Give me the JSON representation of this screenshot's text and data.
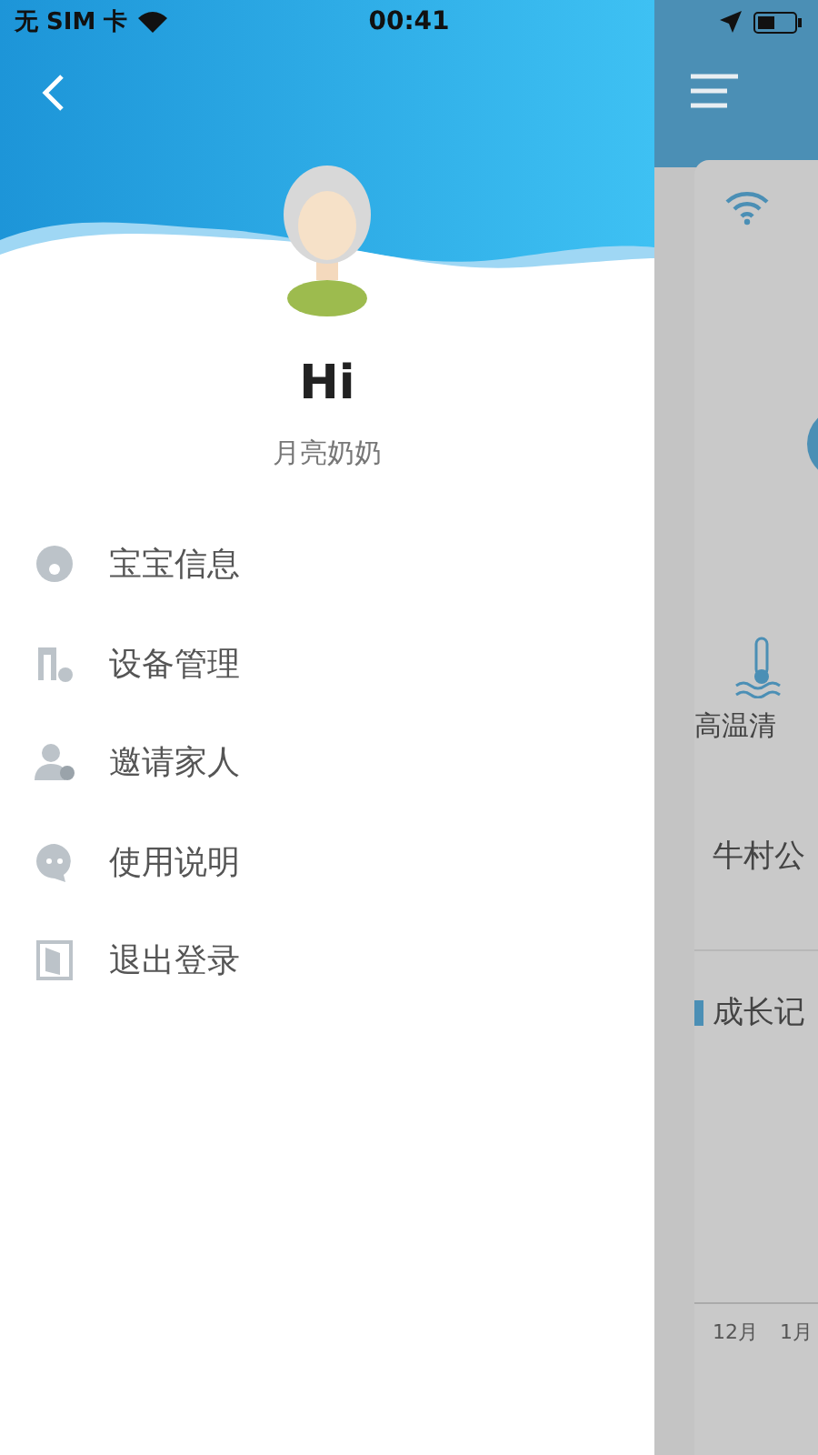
{
  "status_bar": {
    "carrier": "无 SIM 卡",
    "time": "00:41"
  },
  "drawer": {
    "greeting": "Hi",
    "user_name": "月亮奶奶",
    "menu": [
      {
        "label": "宝宝信息",
        "kind": "baby"
      },
      {
        "label": "设备管理",
        "kind": "device"
      },
      {
        "label": "邀请家人",
        "kind": "invite"
      },
      {
        "label": "使用说明",
        "kind": "help"
      },
      {
        "label": "退出登录",
        "kind": "logout"
      }
    ]
  },
  "background_screen": {
    "feature_label": "高温清",
    "location": "牛村公",
    "section_title": "成长记",
    "axis_labels": [
      "12月",
      "1月"
    ]
  }
}
